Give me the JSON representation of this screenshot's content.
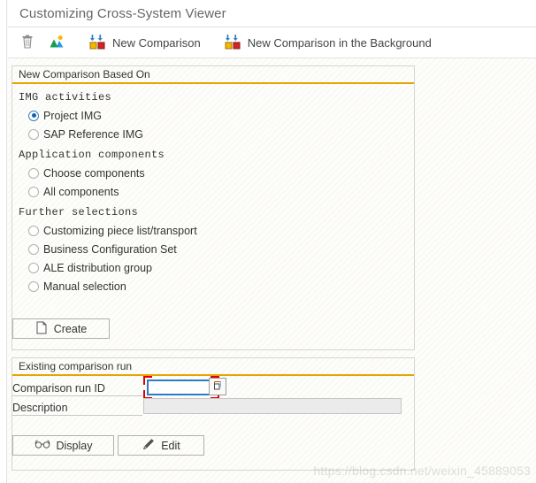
{
  "window": {
    "title": "Customizing Cross-System Viewer"
  },
  "toolbar": {
    "items": [
      {
        "icon": "trash-icon",
        "label": ""
      },
      {
        "icon": "picture-icon",
        "label": ""
      },
      {
        "icon": "compare-icon",
        "label": "New Comparison"
      },
      {
        "icon": "compare-icon",
        "label": "New Comparison in the Background"
      }
    ],
    "delete_icon": "trash-icon",
    "picture_icon": "picture-icon",
    "new_comparison_icon": "compare-icon",
    "new_comparison_label": "New Comparison",
    "new_comparison_bg_icon": "compare-icon",
    "new_comparison_bg_label": "New Comparison in the Background"
  },
  "new_comparison_panel": {
    "header": "New Comparison Based On",
    "groups": [
      {
        "title": "IMG activities",
        "options": [
          {
            "label": "Project IMG",
            "checked": true
          },
          {
            "label": "SAP Reference IMG",
            "checked": false
          }
        ]
      },
      {
        "title": "Application components",
        "options": [
          {
            "label": "Choose components",
            "checked": false
          },
          {
            "label": "All components",
            "checked": false
          }
        ]
      },
      {
        "title": "Further selections",
        "options": [
          {
            "label": "Customizing piece list/transport",
            "checked": false
          },
          {
            "label": "Business Configuration Set",
            "checked": false
          },
          {
            "label": "ALE distribution group",
            "checked": false
          },
          {
            "label": "Manual selection",
            "checked": false
          }
        ]
      }
    ],
    "create_button": {
      "label": "Create",
      "icon": "document-icon"
    }
  },
  "existing_run_panel": {
    "header": "Existing comparison run",
    "fields": {
      "comparison_run_id": {
        "label": "Comparison run ID",
        "value": "",
        "placeholder": "",
        "required": true,
        "help_icon": "value-help-icon"
      },
      "description": {
        "label": "Description",
        "value": "",
        "placeholder": "",
        "readonly": true
      }
    },
    "display_button": {
      "label": "Display",
      "icon": "glasses-icon"
    },
    "edit_button": {
      "label": "Edit",
      "icon": "pencil-icon"
    }
  },
  "watermark": {
    "text": "https://blog.csdn.net/weixin_45889053"
  },
  "colors": {
    "panel_accent": "#e8a400",
    "panel_border": "#d4d4d4",
    "focus_border": "#2b7cc4",
    "required_marker": "#e00000",
    "radio_selected": "#0a64b4",
    "title_text": "#666666"
  }
}
